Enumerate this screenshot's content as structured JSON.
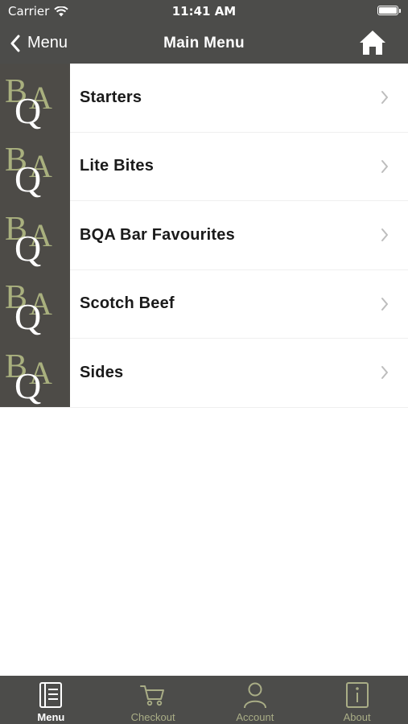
{
  "status_bar": {
    "carrier": "Carrier",
    "time": "11:41 AM"
  },
  "nav_bar": {
    "back_label": "Menu",
    "title": "Main Menu"
  },
  "menu": {
    "logo_text": "BQA",
    "items": [
      {
        "label": "Starters"
      },
      {
        "label": "Lite Bites"
      },
      {
        "label": "BQA Bar Favourites"
      },
      {
        "label": "Scotch Beef"
      },
      {
        "label": "Sides"
      }
    ]
  },
  "tab_bar": {
    "tabs": [
      {
        "label": "Menu",
        "icon": "menu-book-icon",
        "active": true
      },
      {
        "label": "Checkout",
        "icon": "cart-icon",
        "active": false
      },
      {
        "label": "Account",
        "icon": "person-icon",
        "active": false
      },
      {
        "label": "About",
        "icon": "info-icon",
        "active": false
      }
    ]
  },
  "colors": {
    "bar_background": "#4c4c4a",
    "logo_background": "#4d4b47",
    "logo_green": "#a9b07e",
    "tab_inactive": "#a9ad86"
  }
}
